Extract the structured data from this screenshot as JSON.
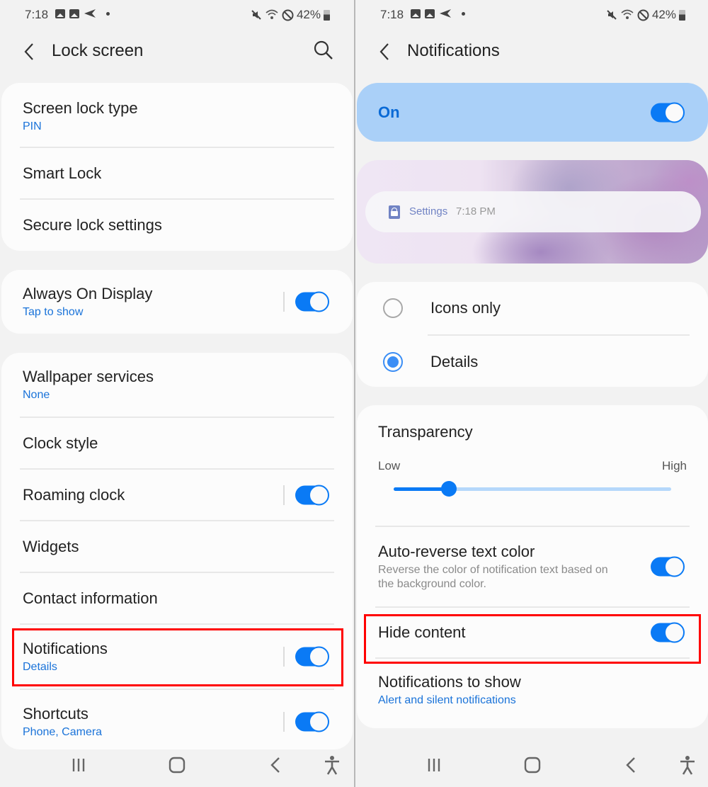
{
  "status_bar": {
    "time": "7:18",
    "battery": "42%",
    "notification_icons": [
      "image-icon",
      "image-icon",
      "send-icon",
      "dot-icon"
    ],
    "system_icons": [
      "mute-icon",
      "wifi-icon",
      "do-not-disturb-icon",
      "battery-icon"
    ]
  },
  "left": {
    "title": "Lock screen",
    "groups": [
      {
        "items": [
          {
            "title": "Screen lock type",
            "subtitle": "PIN"
          },
          {
            "title": "Smart Lock"
          },
          {
            "title": "Secure lock settings"
          }
        ]
      },
      {
        "items": [
          {
            "title": "Always On Display",
            "subtitle": "Tap to show",
            "toggle": true
          }
        ]
      },
      {
        "items": [
          {
            "title": "Wallpaper services",
            "subtitle": "None"
          },
          {
            "title": "Clock style"
          },
          {
            "title": "Roaming clock",
            "toggle": true
          },
          {
            "title": "Widgets"
          },
          {
            "title": "Contact information"
          },
          {
            "title": "Notifications",
            "subtitle": "Details",
            "toggle": true,
            "highlighted": true
          },
          {
            "title": "Shortcuts",
            "subtitle": "Phone, Camera",
            "toggle": true
          }
        ]
      }
    ]
  },
  "right": {
    "title": "Notifications",
    "master": {
      "label": "On",
      "toggle": true
    },
    "preview": {
      "app": "Settings",
      "time": "7:18 PM"
    },
    "style_options": [
      {
        "label": "Icons only",
        "selected": false
      },
      {
        "label": "Details",
        "selected": true
      }
    ],
    "transparency": {
      "title": "Transparency",
      "low_label": "Low",
      "high_label": "High",
      "value_fraction": 0.2
    },
    "auto_reverse": {
      "title": "Auto-reverse text color",
      "description": "Reverse the color of notification text based on the background color.",
      "toggle": true
    },
    "hide_content": {
      "title": "Hide content",
      "toggle": true,
      "highlighted": true
    },
    "notifications_to_show": {
      "title": "Notifications to show",
      "subtitle": "Alert and silent notifications"
    }
  },
  "colors": {
    "accent": "#0a7af5",
    "link": "#1a73d9",
    "highlight": "#ff0000",
    "master_bg": "#aad0f8"
  }
}
